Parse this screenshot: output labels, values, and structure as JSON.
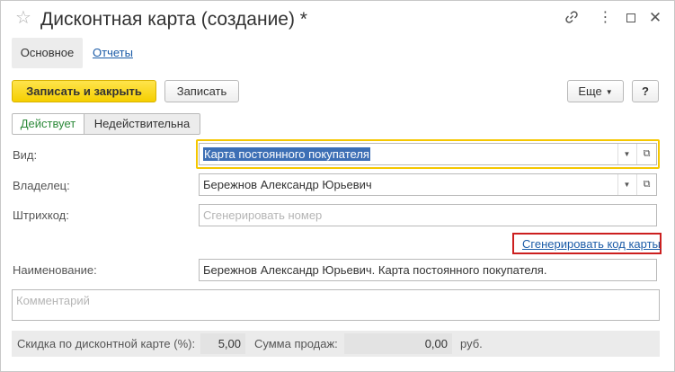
{
  "window": {
    "title": "Дисконтная карта (создание) *",
    "icons": [
      "star-icon",
      "link-icon",
      "more-icon",
      "maximize-icon",
      "close-icon"
    ]
  },
  "tabs": [
    {
      "label": "Основное",
      "active": true
    },
    {
      "label": "Отчеты",
      "active": false
    }
  ],
  "toolbar": {
    "save_close_label": "Записать и закрыть",
    "save_label": "Записать",
    "more_label": "Еще",
    "help_label": "?"
  },
  "status_switch": {
    "active_label": "Действует",
    "inactive_label": "Недействительна"
  },
  "form": {
    "vid": {
      "label": "Вид:",
      "value": "Карта постоянного покупателя"
    },
    "owner": {
      "label": "Владелец:",
      "value": "Бережнов Александр Юрьевич"
    },
    "barcode": {
      "label": "Штрихкод:",
      "placeholder": "Сгенерировать номер"
    },
    "generate_link": "Сгенерировать код карты",
    "name": {
      "label": "Наименование:",
      "value": "Бережнов Александр Юрьевич. Карта постоянного покупателя."
    },
    "comment": {
      "placeholder": "Комментарий"
    }
  },
  "footer": {
    "discount_label": "Скидка по дисконтной карте (%):",
    "discount_value": "5,00",
    "sales_label": "Сумма продаж:",
    "sales_value": "0,00",
    "currency": "руб."
  },
  "colors": {
    "primary_button": "#f5cf00",
    "focus_border": "#f5c700",
    "highlight_border": "#cc1f1f",
    "link": "#1c5ca8",
    "active_status": "#2d8a3a"
  }
}
